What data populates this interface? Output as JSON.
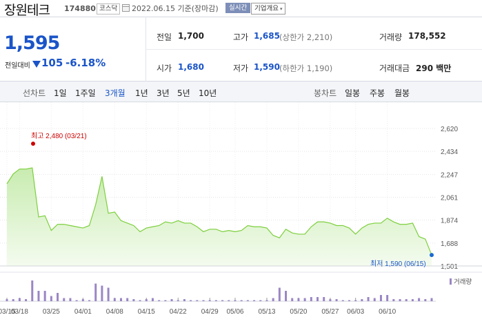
{
  "header": {
    "name": "장원테크",
    "code": "174880",
    "market": "코스닥",
    "date": "2022.06.15 기준(장마감)",
    "realtime": "실시간",
    "corp_info": "기업개요",
    "corp_arrow": "▾"
  },
  "price": {
    "current": "1,595",
    "change_label": "전일대비",
    "change": "105",
    "change_pct": "-6.18%"
  },
  "stats": {
    "prev_label": "전일",
    "prev": "1,700",
    "open_label": "시가",
    "open": "1,680",
    "high_label": "고가",
    "high": "1,685",
    "high_sub": "(상한가 2,210)",
    "low_label": "저가",
    "low": "1,590",
    "low_sub": "(하한가 1,190)",
    "volume_label": "거래량",
    "volume": "178,552",
    "amount_label": "거래대금",
    "amount": "290 백만"
  },
  "tabs": {
    "line_label": "선차트",
    "periods": [
      "1일",
      "1주일",
      "3개월",
      "1년",
      "3년",
      "5년",
      "10년"
    ],
    "selected": "3개월",
    "candle_label": "봉차트",
    "candles": [
      "일봉",
      "주봉",
      "월봉"
    ]
  },
  "chart_data": {
    "type": "area",
    "price_color": "#7ccf3c",
    "volume_color": "#9a86c4",
    "yticks": [
      "2,620",
      "2,434",
      "2,247",
      "2,061",
      "1,874",
      "1,688",
      "1,501"
    ],
    "ylim": [
      1501,
      2620
    ],
    "xticks": [
      "03/15",
      "03/18",
      "03/25",
      "04/01",
      "04/08",
      "04/15",
      "04/22",
      "04/29",
      "05/06",
      "05/13",
      "05/20",
      "05/27",
      "06/03",
      "06/10"
    ],
    "max_annotation": "최고 2,480 (03/21)",
    "min_annotation": "최저 1,590 (06/15)",
    "volume_legend": "거래량",
    "prices": [
      2170,
      2250,
      2290,
      2290,
      2300,
      1900,
      1910,
      1790,
      1840,
      1840,
      1830,
      1820,
      1810,
      1830,
      2000,
      2230,
      1930,
      1940,
      1870,
      1850,
      1830,
      1780,
      1810,
      1820,
      1830,
      1860,
      1850,
      1870,
      1850,
      1850,
      1820,
      1780,
      1800,
      1800,
      1780,
      1790,
      1780,
      1790,
      1830,
      1820,
      1820,
      1810,
      1750,
      1730,
      1800,
      1770,
      1760,
      1760,
      1820,
      1860,
      1860,
      1850,
      1830,
      1830,
      1810,
      1760,
      1810,
      1840,
      1850,
      1850,
      1890,
      1860,
      1840,
      1840,
      1850,
      1740,
      1720,
      1590
    ],
    "volumes": [
      2,
      2,
      3,
      2,
      20,
      10,
      10,
      5,
      8,
      3,
      3,
      1,
      2,
      1,
      17,
      15,
      13,
      3,
      3,
      3,
      2,
      1,
      2,
      3,
      1,
      1,
      2,
      1,
      2,
      1,
      1,
      1,
      1,
      1,
      1,
      1,
      1,
      1,
      1,
      1,
      1,
      1,
      3,
      13,
      10,
      3,
      3,
      3,
      4,
      4,
      4,
      2,
      2,
      1,
      1,
      1,
      2,
      4,
      3,
      6,
      6,
      2,
      2,
      2,
      2,
      3,
      2,
      3
    ]
  }
}
